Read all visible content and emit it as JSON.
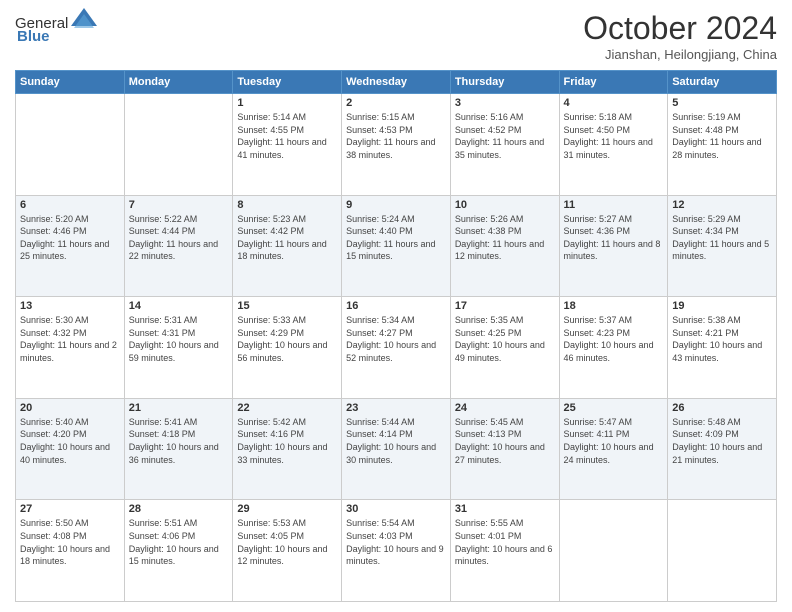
{
  "header": {
    "logo_general": "General",
    "logo_blue": "Blue",
    "month_title": "October 2024",
    "location": "Jianshan, Heilongjiang, China"
  },
  "calendar": {
    "days_of_week": [
      "Sunday",
      "Monday",
      "Tuesday",
      "Wednesday",
      "Thursday",
      "Friday",
      "Saturday"
    ],
    "weeks": [
      [
        {
          "day": "",
          "info": ""
        },
        {
          "day": "",
          "info": ""
        },
        {
          "day": "1",
          "info": "Sunrise: 5:14 AM\nSunset: 4:55 PM\nDaylight: 11 hours and 41 minutes."
        },
        {
          "day": "2",
          "info": "Sunrise: 5:15 AM\nSunset: 4:53 PM\nDaylight: 11 hours and 38 minutes."
        },
        {
          "day": "3",
          "info": "Sunrise: 5:16 AM\nSunset: 4:52 PM\nDaylight: 11 hours and 35 minutes."
        },
        {
          "day": "4",
          "info": "Sunrise: 5:18 AM\nSunset: 4:50 PM\nDaylight: 11 hours and 31 minutes."
        },
        {
          "day": "5",
          "info": "Sunrise: 5:19 AM\nSunset: 4:48 PM\nDaylight: 11 hours and 28 minutes."
        }
      ],
      [
        {
          "day": "6",
          "info": "Sunrise: 5:20 AM\nSunset: 4:46 PM\nDaylight: 11 hours and 25 minutes."
        },
        {
          "day": "7",
          "info": "Sunrise: 5:22 AM\nSunset: 4:44 PM\nDaylight: 11 hours and 22 minutes."
        },
        {
          "day": "8",
          "info": "Sunrise: 5:23 AM\nSunset: 4:42 PM\nDaylight: 11 hours and 18 minutes."
        },
        {
          "day": "9",
          "info": "Sunrise: 5:24 AM\nSunset: 4:40 PM\nDaylight: 11 hours and 15 minutes."
        },
        {
          "day": "10",
          "info": "Sunrise: 5:26 AM\nSunset: 4:38 PM\nDaylight: 11 hours and 12 minutes."
        },
        {
          "day": "11",
          "info": "Sunrise: 5:27 AM\nSunset: 4:36 PM\nDaylight: 11 hours and 8 minutes."
        },
        {
          "day": "12",
          "info": "Sunrise: 5:29 AM\nSunset: 4:34 PM\nDaylight: 11 hours and 5 minutes."
        }
      ],
      [
        {
          "day": "13",
          "info": "Sunrise: 5:30 AM\nSunset: 4:32 PM\nDaylight: 11 hours and 2 minutes."
        },
        {
          "day": "14",
          "info": "Sunrise: 5:31 AM\nSunset: 4:31 PM\nDaylight: 10 hours and 59 minutes."
        },
        {
          "day": "15",
          "info": "Sunrise: 5:33 AM\nSunset: 4:29 PM\nDaylight: 10 hours and 56 minutes."
        },
        {
          "day": "16",
          "info": "Sunrise: 5:34 AM\nSunset: 4:27 PM\nDaylight: 10 hours and 52 minutes."
        },
        {
          "day": "17",
          "info": "Sunrise: 5:35 AM\nSunset: 4:25 PM\nDaylight: 10 hours and 49 minutes."
        },
        {
          "day": "18",
          "info": "Sunrise: 5:37 AM\nSunset: 4:23 PM\nDaylight: 10 hours and 46 minutes."
        },
        {
          "day": "19",
          "info": "Sunrise: 5:38 AM\nSunset: 4:21 PM\nDaylight: 10 hours and 43 minutes."
        }
      ],
      [
        {
          "day": "20",
          "info": "Sunrise: 5:40 AM\nSunset: 4:20 PM\nDaylight: 10 hours and 40 minutes."
        },
        {
          "day": "21",
          "info": "Sunrise: 5:41 AM\nSunset: 4:18 PM\nDaylight: 10 hours and 36 minutes."
        },
        {
          "day": "22",
          "info": "Sunrise: 5:42 AM\nSunset: 4:16 PM\nDaylight: 10 hours and 33 minutes."
        },
        {
          "day": "23",
          "info": "Sunrise: 5:44 AM\nSunset: 4:14 PM\nDaylight: 10 hours and 30 minutes."
        },
        {
          "day": "24",
          "info": "Sunrise: 5:45 AM\nSunset: 4:13 PM\nDaylight: 10 hours and 27 minutes."
        },
        {
          "day": "25",
          "info": "Sunrise: 5:47 AM\nSunset: 4:11 PM\nDaylight: 10 hours and 24 minutes."
        },
        {
          "day": "26",
          "info": "Sunrise: 5:48 AM\nSunset: 4:09 PM\nDaylight: 10 hours and 21 minutes."
        }
      ],
      [
        {
          "day": "27",
          "info": "Sunrise: 5:50 AM\nSunset: 4:08 PM\nDaylight: 10 hours and 18 minutes."
        },
        {
          "day": "28",
          "info": "Sunrise: 5:51 AM\nSunset: 4:06 PM\nDaylight: 10 hours and 15 minutes."
        },
        {
          "day": "29",
          "info": "Sunrise: 5:53 AM\nSunset: 4:05 PM\nDaylight: 10 hours and 12 minutes."
        },
        {
          "day": "30",
          "info": "Sunrise: 5:54 AM\nSunset: 4:03 PM\nDaylight: 10 hours and 9 minutes."
        },
        {
          "day": "31",
          "info": "Sunrise: 5:55 AM\nSunset: 4:01 PM\nDaylight: 10 hours and 6 minutes."
        },
        {
          "day": "",
          "info": ""
        },
        {
          "day": "",
          "info": ""
        }
      ]
    ]
  }
}
